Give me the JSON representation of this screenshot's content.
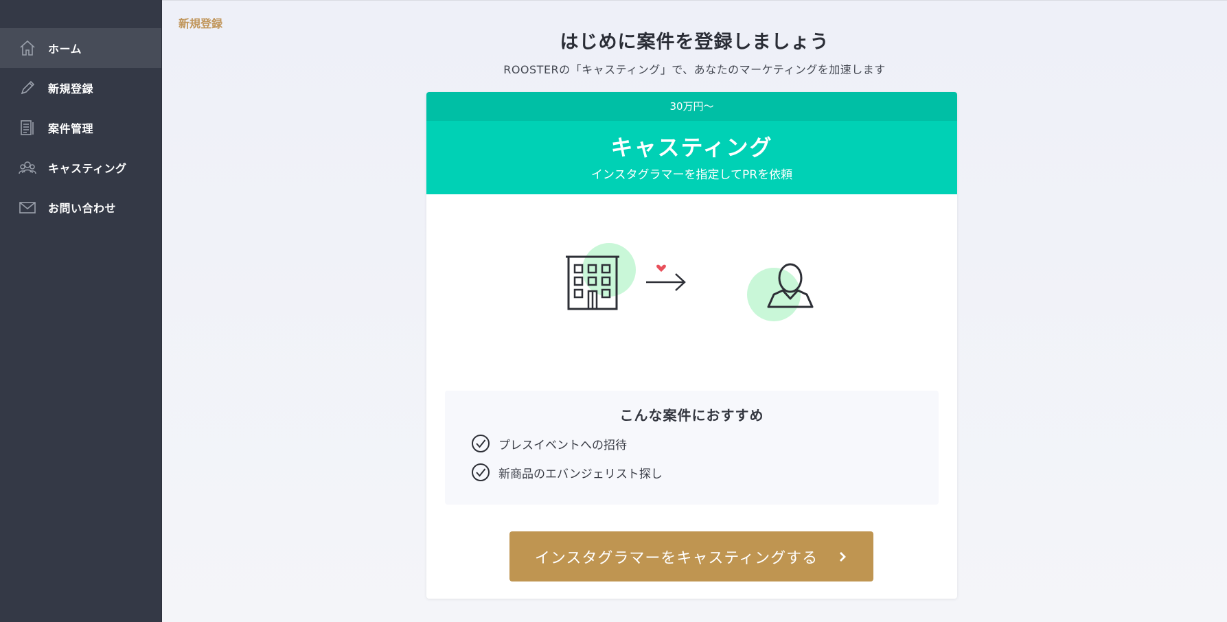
{
  "sidebar": {
    "items": [
      {
        "label": "ホーム",
        "icon": "home-icon",
        "active": true
      },
      {
        "label": "新規登録",
        "icon": "pencil-icon"
      },
      {
        "label": "案件管理",
        "icon": "document-icon"
      },
      {
        "label": "キャスティング",
        "icon": "people-icon"
      },
      {
        "label": "お問い合わせ",
        "icon": "mail-icon"
      }
    ]
  },
  "header": {
    "breadcrumb": "新規登録",
    "title": "はじめに案件を登録しましょう",
    "subtitle": "ROOSTERの「キャスティング」で、あなたのマーケティングを加速します"
  },
  "card": {
    "price": "30万円〜",
    "title": "キャスティング",
    "description": "インスタグラマーを指定してPRを依頼",
    "recommend_title": "こんな案件におすすめ",
    "recommend_items": [
      "プレスイベントへの招待",
      "新商品のエバンジェリスト探し"
    ],
    "cta_label": "インスタグラマーをキャスティングする"
  },
  "colors": {
    "sidebar_bg": "#343946",
    "accent_teal": "#00d1b5",
    "accent_teal_dark": "#00bfa5",
    "cta_gold": "#bf9551",
    "breadcrumb": "#c0955a",
    "illus_green": "#c9f7d8",
    "heart": "#e8505b"
  }
}
